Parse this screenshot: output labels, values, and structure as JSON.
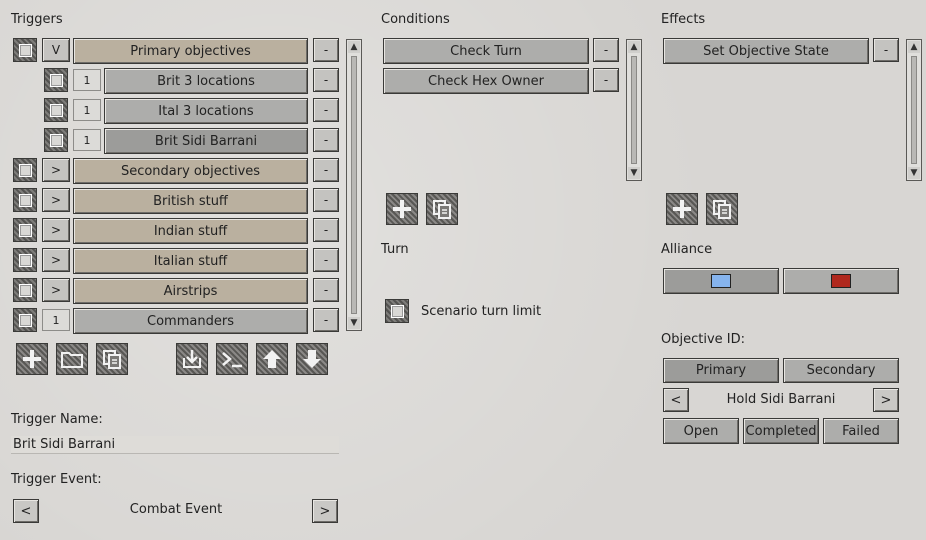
{
  "triggers": {
    "header": "Triggers",
    "rows": [
      {
        "toggle": "V",
        "label": "Primary objectives",
        "style": "tan",
        "indent": false
      },
      {
        "toggle": "1",
        "label": "Brit 3 locations",
        "style": "gray",
        "indent": true
      },
      {
        "toggle": "1",
        "label": "Ital 3 locations",
        "style": "gray",
        "indent": true
      },
      {
        "toggle": "1",
        "label": "Brit Sidi Barrani",
        "style": "gray-dark",
        "indent": true
      },
      {
        "toggle": ">",
        "label": "Secondary objectives",
        "style": "tan",
        "indent": false
      },
      {
        "toggle": ">",
        "label": "British stuff",
        "style": "tan",
        "indent": false
      },
      {
        "toggle": ">",
        "label": "Indian stuff",
        "style": "tan",
        "indent": false
      },
      {
        "toggle": ">",
        "label": "Italian stuff",
        "style": "tan",
        "indent": false
      },
      {
        "toggle": ">",
        "label": "Airstrips",
        "style": "tan",
        "indent": false
      },
      {
        "toggle": "1",
        "label": "Commanders",
        "style": "gray",
        "indent": false
      }
    ],
    "remove_label": "-",
    "toolbar_icons": [
      "plus-icon",
      "folder-icon",
      "copy-icon",
      "import-icon",
      "console-icon",
      "arrow-up-icon",
      "arrow-down-icon"
    ]
  },
  "trigger_name": {
    "label": "Trigger Name:",
    "value": "Brit Sidi Barrani"
  },
  "trigger_event": {
    "label": "Trigger Event:",
    "value": "Combat Event",
    "prev": "<",
    "next": ">"
  },
  "conditions": {
    "header": "Conditions",
    "items": [
      "Check Turn",
      "Check Hex Owner"
    ],
    "remove_label": "-"
  },
  "turn": {
    "header": "Turn",
    "checkbox_label": "Scenario turn limit"
  },
  "effects": {
    "header": "Effects",
    "items": [
      "Set Objective State"
    ],
    "remove_label": "-"
  },
  "alliance": {
    "header": "Alliance",
    "colors": [
      "#86b4ee",
      "#b0281e"
    ]
  },
  "objective": {
    "header": "Objective ID:",
    "tabs": [
      "Primary",
      "Secondary"
    ],
    "name": "Hold Sidi Barrani",
    "prev": "<",
    "next": ">",
    "states": [
      "Open",
      "Completed",
      "Failed"
    ]
  }
}
